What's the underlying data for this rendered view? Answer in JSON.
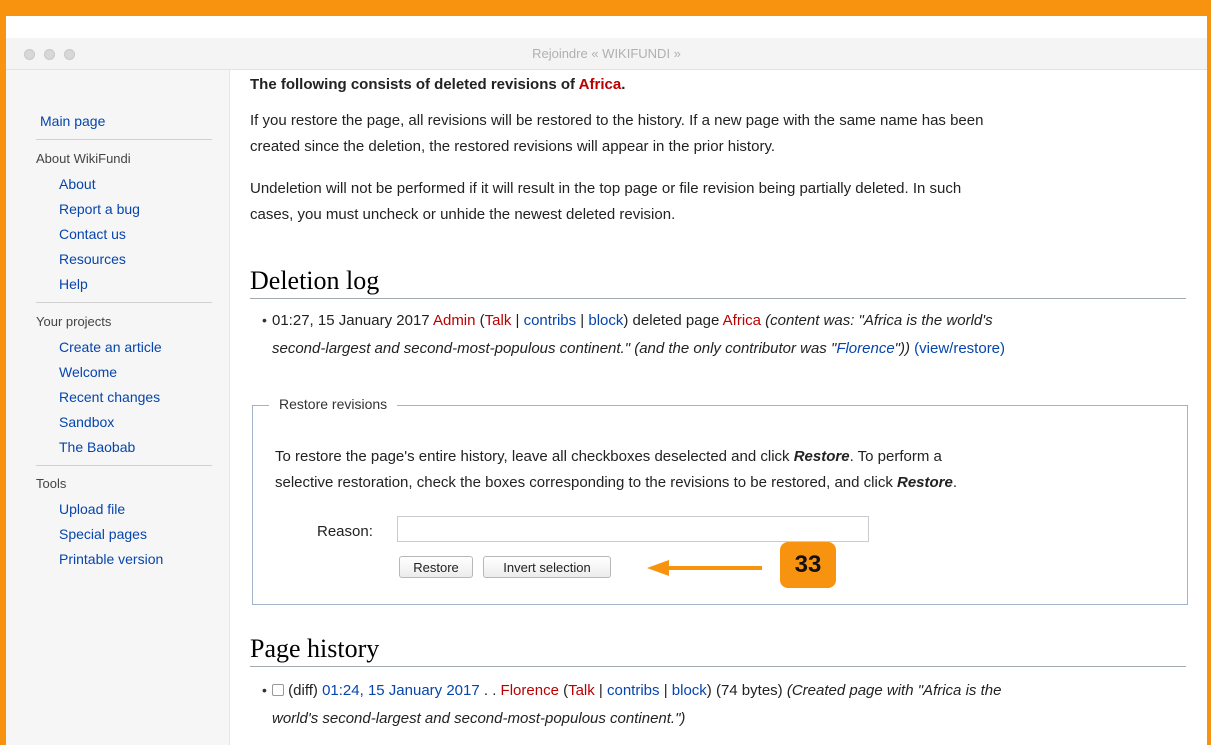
{
  "window": {
    "title": "Rejoindre « WIKIFUNDI »"
  },
  "sidebar": {
    "main_page": "Main page",
    "section_about": {
      "heading": "About WikiFundi",
      "items": [
        "About",
        "Report a bug",
        "Contact us",
        "Resources",
        "Help"
      ]
    },
    "section_projects": {
      "heading": "Your projects",
      "items": [
        "Create an article",
        "Welcome",
        "Recent changes",
        "Sandbox",
        "The Baobab"
      ]
    },
    "section_tools": {
      "heading": "Tools",
      "items": [
        "Upload file",
        "Special pages",
        "Printable version"
      ]
    }
  },
  "main": {
    "intro_prefix": "The following consists of deleted revisions of ",
    "intro_page": "Africa",
    "intro_suffix": ".",
    "para1_line1": "If you restore the page, all revisions will be restored to the history. If a new page with the same name has been",
    "para1_line2": "created since the deletion, the restored revisions will appear in the prior history.",
    "para2_line1": "Undeletion will not be performed if it will result in the top page or file revision being partially deleted. In such",
    "para2_line2": "cases, you must uncheck or unhide the newest deleted revision."
  },
  "deletion_log": {
    "heading": "Deletion log",
    "entry": {
      "time": "01:27, 15 January 2017",
      "user": "Admin",
      "open_paren": " (",
      "talk": "Talk",
      "sep1": " | ",
      "contribs": "contribs",
      "sep2": " | ",
      "block": "block",
      "close_paren": ")",
      "action": " deleted page ",
      "page": "Africa",
      "content_prefix": " (content was: \"Africa is the world's",
      "content_line2": "second-largest and second-most-populous continent.\" (and the only contributor was \"",
      "contributor": "Florence",
      "content_suffix": "\"))",
      "view_restore": "(view/restore)"
    }
  },
  "restore_box": {
    "legend": "Restore revisions",
    "line1_a": "To restore the page's entire history, leave all checkboxes deselected and click ",
    "line1_b": "Restore",
    "line1_c": ". To perform a",
    "line2_a": "selective restoration, check the boxes corresponding to the revisions to be restored, and click ",
    "line2_b": "Restore",
    "line2_c": ".",
    "reason_label": "Reason:",
    "reason_value": "",
    "restore_button": "Restore",
    "invert_button": "Invert selection"
  },
  "annotation": {
    "badge": "33",
    "color": "#f7930f"
  },
  "page_history": {
    "heading": "Page history",
    "entry": {
      "diff": "(diff)",
      "time": "01:24, 15 January 2017",
      "dots": " . . ",
      "user": "Florence",
      "open_paren": " (",
      "talk": "Talk",
      "sep1": " | ",
      "contribs": "contribs",
      "sep2": " | ",
      "block": "block",
      "close_paren": ")",
      "size": " (74 bytes) ",
      "summary_line1": "(Created page with \"Africa is the",
      "summary_line2": "world's second-largest and second-most-populous continent.\")"
    }
  }
}
